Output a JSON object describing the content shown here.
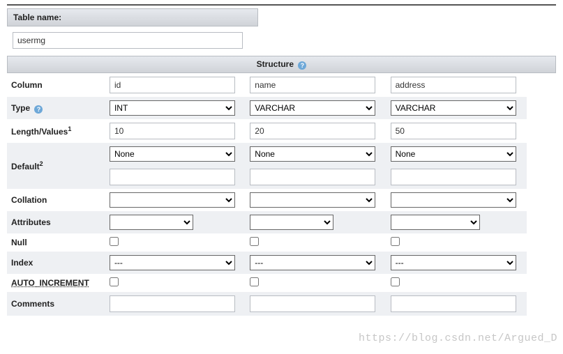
{
  "tableNameLabel": "Table name:",
  "tableNameValue": "usermg",
  "structureHeader": "Structure",
  "labels": {
    "column": "Column",
    "type": "Type",
    "length": "Length/Values",
    "lengthSup": "1",
    "default": "Default",
    "defaultSup": "2",
    "collation": "Collation",
    "attributes": "Attributes",
    "null": "Null",
    "index": "Index",
    "autoIncrement": "AUTO_INCREMENT",
    "comments": "Comments"
  },
  "cols": [
    {
      "name": "id",
      "type": "INT",
      "length": "10",
      "default": "None",
      "defaultExtra": "",
      "collation": "",
      "attributes": "",
      "null": false,
      "index": "---",
      "autoInc": false,
      "comments": ""
    },
    {
      "name": "name",
      "type": "VARCHAR",
      "length": "20",
      "default": "None",
      "defaultExtra": "",
      "collation": "",
      "attributes": "",
      "null": false,
      "index": "---",
      "autoInc": false,
      "comments": ""
    },
    {
      "name": "address",
      "type": "VARCHAR",
      "length": "50",
      "default": "None",
      "defaultExtra": "",
      "collation": "",
      "attributes": "",
      "null": false,
      "index": "---",
      "autoInc": false,
      "comments": ""
    }
  ],
  "watermark": "https://blog.csdn.net/Argued_D"
}
